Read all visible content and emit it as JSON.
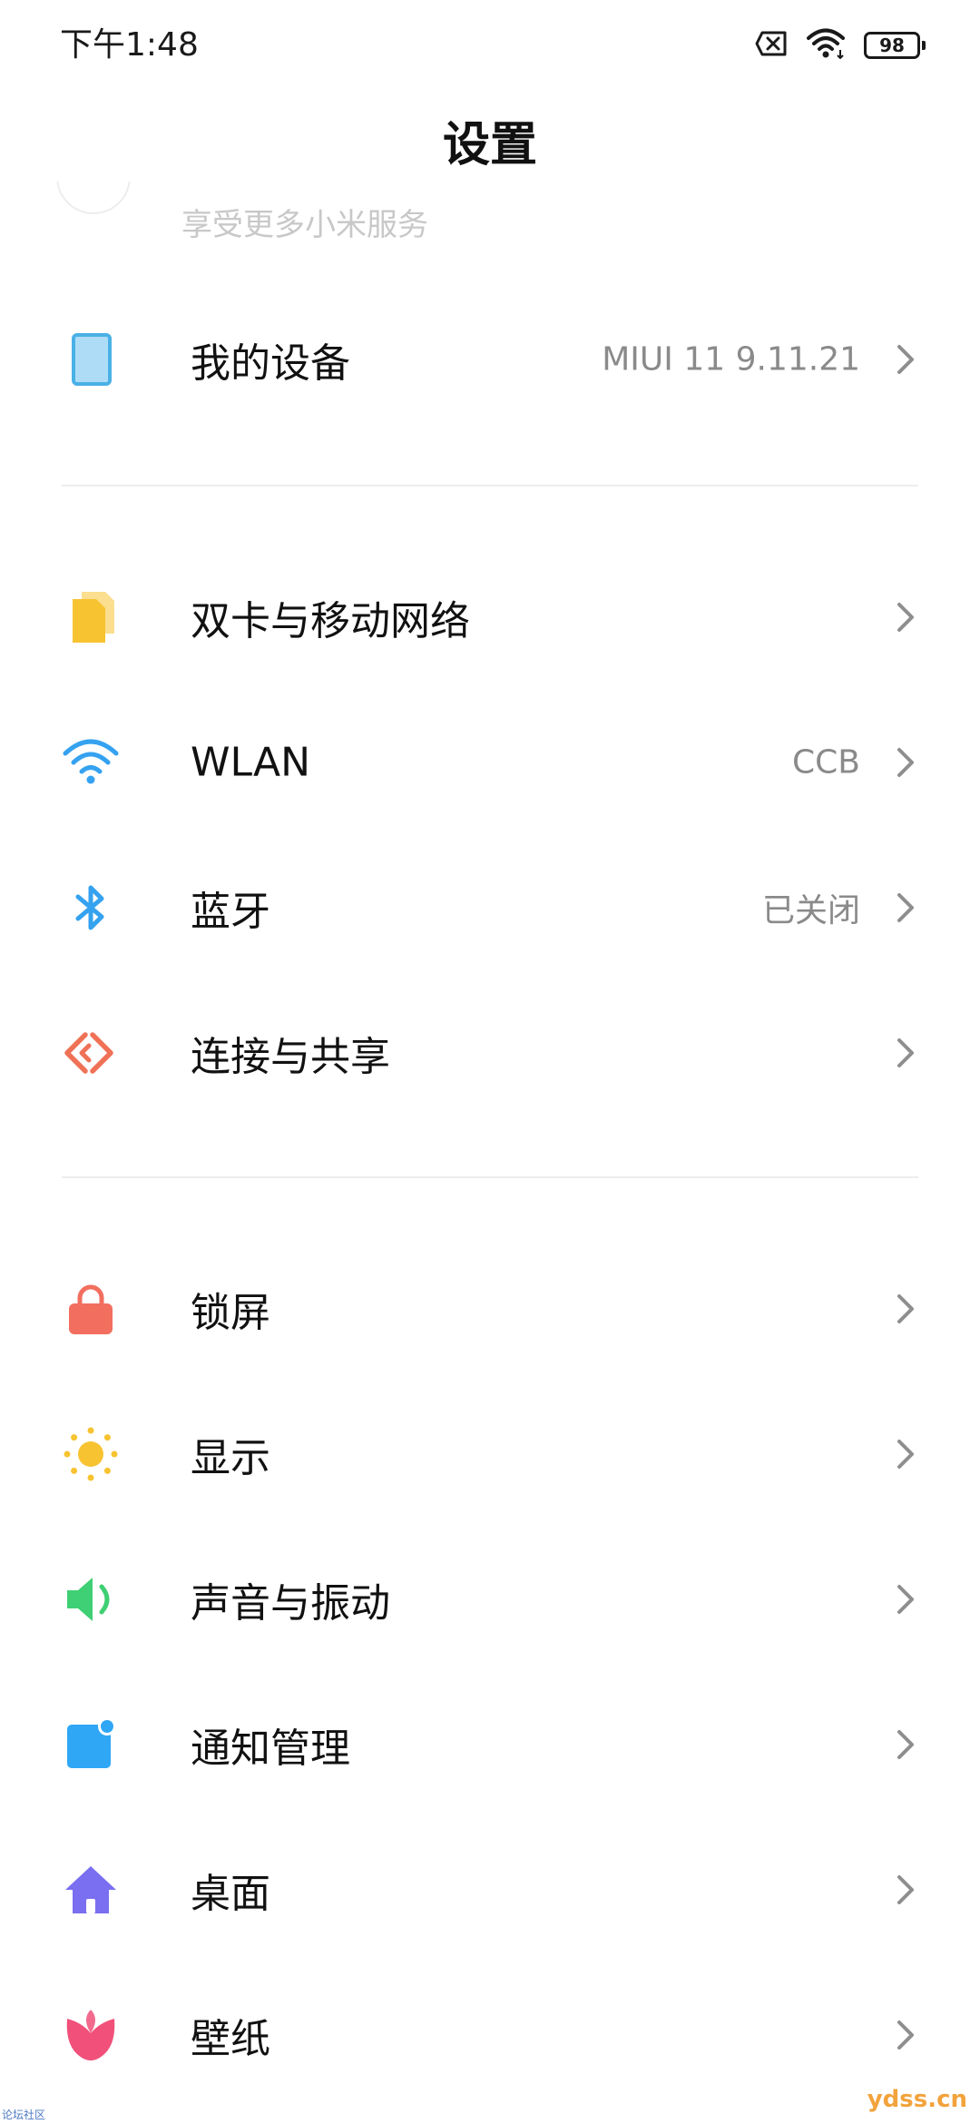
{
  "status_bar": {
    "time": "下午1:48",
    "battery": "98"
  },
  "header": {
    "title": "设置"
  },
  "account_row": {
    "subtitle": "享受更多小米服务"
  },
  "sections": [
    {
      "items": [
        {
          "label": "我的设备",
          "value": "MIUI 11 9.11.21",
          "icon": "phone-device-icon",
          "color": "#4ab1e6"
        }
      ]
    },
    {
      "items": [
        {
          "label": "双卡与移动网络",
          "value": "",
          "icon": "sim-card-icon",
          "color": "#f7c331"
        },
        {
          "label": "WLAN",
          "value": "CCB",
          "icon": "wifi-icon",
          "color": "#35a2f0"
        },
        {
          "label": "蓝牙",
          "value": "已关闭",
          "icon": "bluetooth-icon",
          "color": "#35a2f0"
        },
        {
          "label": "连接与共享",
          "value": "",
          "icon": "connection-share-icon",
          "color": "#ef7257"
        }
      ]
    },
    {
      "items": [
        {
          "label": "锁屏",
          "value": "",
          "icon": "lock-icon",
          "color": "#f26f5f"
        },
        {
          "label": "显示",
          "value": "",
          "icon": "sun-icon",
          "color": "#f7c331"
        },
        {
          "label": "声音与振动",
          "value": "",
          "icon": "speaker-icon",
          "color": "#3fcf74"
        },
        {
          "label": "通知管理",
          "value": "",
          "icon": "notification-icon",
          "color": "#2fa7f5"
        },
        {
          "label": "桌面",
          "value": "",
          "icon": "home-icon",
          "color": "#7a6ff0"
        },
        {
          "label": "壁纸",
          "value": "",
          "icon": "tulip-icon",
          "color": "#f0507a"
        }
      ]
    }
  ],
  "watermark": {
    "brand": "ydss.cn",
    "community": "论坛社区"
  }
}
